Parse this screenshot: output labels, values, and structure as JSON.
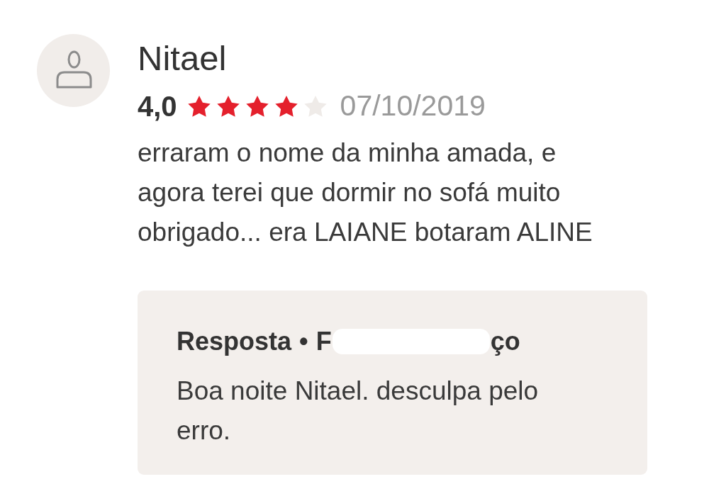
{
  "review": {
    "author": "Nitael",
    "rating": "4,0",
    "stars": 4,
    "date": "07/10/2019",
    "text": "erraram o nome da minha amada, e agora terei que dormir no sofá muito obrigado... era LAIANE botaram ALINE"
  },
  "reply": {
    "label": "Resposta",
    "separator": "•",
    "store_name_start": "F",
    "redacted": true,
    "store_name_end": "ço",
    "text": "Boa noite Nitael. desculpa pelo erro."
  }
}
